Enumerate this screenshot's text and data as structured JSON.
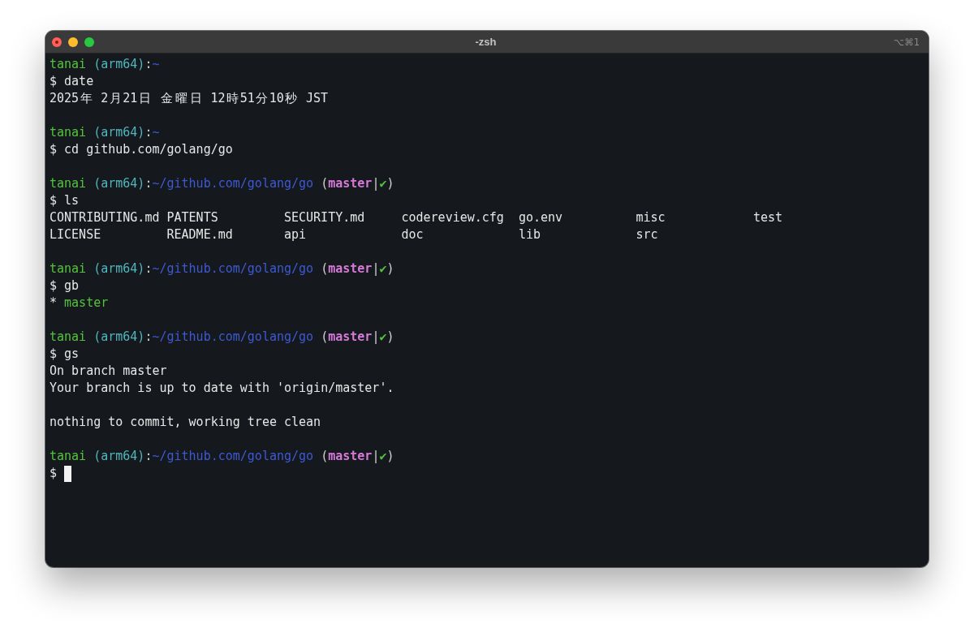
{
  "window": {
    "title": "-zsh",
    "shortcut": "⌥⌘1",
    "controls": [
      {
        "kind": "close"
      },
      {
        "kind": "minimize"
      },
      {
        "kind": "zoom"
      }
    ]
  },
  "terminal": {
    "blocks": [
      {
        "prompt": [
          {
            "kind": "user",
            "text": "tanai"
          },
          {
            "kind": "arch",
            "text": " (arm64)"
          },
          {
            "kind": "plain",
            "text": ":"
          },
          {
            "kind": "path",
            "text": "~"
          }
        ],
        "command": {
          "text": "$ date",
          "cursor": false
        },
        "output": [
          {
            "kind": "text",
            "text": "2025年 2月21日 金曜日 12時51分10秒 JST"
          }
        ]
      },
      {
        "prompt": [
          {
            "kind": "user",
            "text": "tanai"
          },
          {
            "kind": "arch",
            "text": " (arm64)"
          },
          {
            "kind": "plain",
            "text": ":"
          },
          {
            "kind": "path",
            "text": "~"
          }
        ],
        "command": {
          "text": "$ cd github.com/golang/go",
          "cursor": false
        }
      },
      {
        "prompt": [
          {
            "kind": "user",
            "text": "tanai"
          },
          {
            "kind": "arch",
            "text": " (arm64)"
          },
          {
            "kind": "plain",
            "text": ":"
          },
          {
            "kind": "path",
            "text": "~/github.com/golang/go"
          },
          {
            "kind": "plain",
            "text": " ("
          },
          {
            "kind": "branch",
            "text": "master"
          },
          {
            "kind": "plain",
            "text": "|"
          },
          {
            "kind": "clean",
            "text": "✔"
          },
          {
            "kind": "plain",
            "text": ")"
          }
        ],
        "command": {
          "text": "$ ls",
          "cursor": false
        },
        "output": [
          {
            "kind": "columns",
            "rows": [
              [
                "CONTRIBUTING.md",
                "PATENTS",
                "SECURITY.md",
                "codereview.cfg",
                "go.env",
                "misc",
                "test"
              ],
              [
                "LICENSE",
                "README.md",
                "api",
                "doc",
                "lib",
                "src"
              ]
            ]
          }
        ]
      },
      {
        "prompt": [
          {
            "kind": "user",
            "text": "tanai"
          },
          {
            "kind": "arch",
            "text": " (arm64)"
          },
          {
            "kind": "plain",
            "text": ":"
          },
          {
            "kind": "path",
            "text": "~/github.com/golang/go"
          },
          {
            "kind": "plain",
            "text": " ("
          },
          {
            "kind": "branch",
            "text": "master"
          },
          {
            "kind": "plain",
            "text": "|"
          },
          {
            "kind": "clean",
            "text": "✔"
          },
          {
            "kind": "plain",
            "text": ")"
          }
        ],
        "command": {
          "text": "$ gb",
          "cursor": false
        },
        "output": [
          {
            "kind": "branch",
            "marker": "*",
            "name": "master",
            "current": true
          }
        ]
      },
      {
        "prompt": [
          {
            "kind": "user",
            "text": "tanai"
          },
          {
            "kind": "arch",
            "text": " (arm64)"
          },
          {
            "kind": "plain",
            "text": ":"
          },
          {
            "kind": "path",
            "text": "~/github.com/golang/go"
          },
          {
            "kind": "plain",
            "text": " ("
          },
          {
            "kind": "branch",
            "text": "master"
          },
          {
            "kind": "plain",
            "text": "|"
          },
          {
            "kind": "clean",
            "text": "✔"
          },
          {
            "kind": "plain",
            "text": ")"
          }
        ],
        "command": {
          "text": "$ gs",
          "cursor": false
        },
        "output": [
          {
            "kind": "text",
            "text": "On branch master"
          },
          {
            "kind": "text",
            "text": "Your branch is up to date with 'origin/master'."
          },
          {
            "kind": "gap"
          },
          {
            "kind": "text",
            "text": "nothing to commit, working tree clean"
          }
        ]
      },
      {
        "prompt": [
          {
            "kind": "user",
            "text": "tanai"
          },
          {
            "kind": "arch",
            "text": " (arm64)"
          },
          {
            "kind": "plain",
            "text": ":"
          },
          {
            "kind": "path",
            "text": "~/github.com/golang/go"
          },
          {
            "kind": "plain",
            "text": " ("
          },
          {
            "kind": "branch",
            "text": "master"
          },
          {
            "kind": "plain",
            "text": "|"
          },
          {
            "kind": "clean",
            "text": "✔"
          },
          {
            "kind": "plain",
            "text": ")"
          }
        ],
        "command": {
          "text": "$",
          "cursor": true
        }
      }
    ]
  }
}
